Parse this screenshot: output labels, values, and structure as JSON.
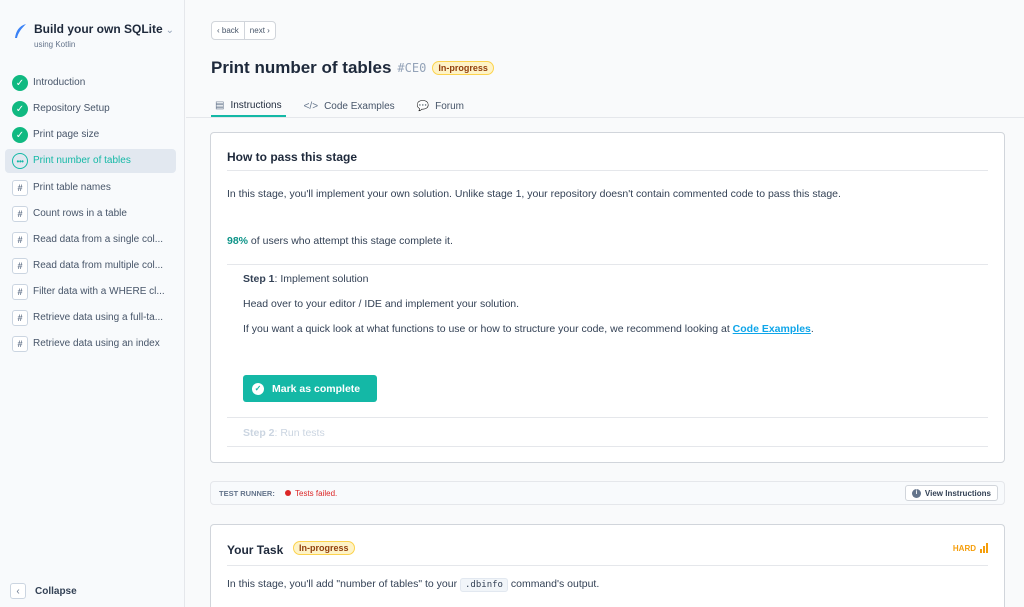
{
  "course": {
    "title": "Build your own SQLite",
    "subtitle": "using Kotlin",
    "chevron_icon": "chevron-down-icon",
    "logo_icon": "feather-icon"
  },
  "stages": [
    {
      "label": "Introduction",
      "status": "done"
    },
    {
      "label": "Repository Setup",
      "status": "done"
    },
    {
      "label": "Print page size",
      "status": "done"
    },
    {
      "label": "Print number of tables",
      "status": "current"
    },
    {
      "label": "Print table names",
      "status": "locked"
    },
    {
      "label": "Count rows in a table",
      "status": "locked"
    },
    {
      "label": "Read data from a single col...",
      "status": "locked"
    },
    {
      "label": "Read data from multiple col...",
      "status": "locked"
    },
    {
      "label": "Filter data with a WHERE cl...",
      "status": "locked"
    },
    {
      "label": "Retrieve data using a full-ta...",
      "status": "locked"
    },
    {
      "label": "Retrieve data using an index",
      "status": "locked"
    }
  ],
  "sidebar_footer": {
    "collapse_label": "Collapse"
  },
  "header": {
    "back_label": "‹ back",
    "next_label": "next ›",
    "title": "Print number of tables",
    "code": "#CE0",
    "status_badge": "In-progress",
    "tabs": [
      {
        "label": "Instructions",
        "icon": "document-icon",
        "glyph": "▤"
      },
      {
        "label": "Code Examples",
        "icon": "code-icon",
        "glyph": "</>"
      },
      {
        "label": "Forum",
        "icon": "chat-icon",
        "glyph": "💬"
      }
    ]
  },
  "instructions": {
    "title": "How to pass this stage",
    "intro": "In this stage, you'll implement your own solution. Unlike stage 1, your repository doesn't contain commented code to pass this stage.",
    "completion_pct": "98%",
    "completion_text": " of users who attempt this stage complete it.",
    "step1_label": "Step 1",
    "step1_title": ": Implement solution",
    "step1_p1": "Head over to your editor / IDE and implement your solution.",
    "step1_p2": "If you want a quick look at what functions to use or how to structure your code, we recommend looking at ",
    "step1_link": "Code Examples",
    "step1_p2_end": ".",
    "mark_button": "Mark as complete",
    "step2_label": "Step 2",
    "step2_title": ": Run tests"
  },
  "test_runner": {
    "label": "TEST RUNNER:",
    "status": "Tests failed.",
    "status_color": "#dc2626",
    "button": "View Instructions"
  },
  "task": {
    "title": "Your Task",
    "badge": "In-progress",
    "difficulty": "HARD",
    "text_before": "In this stage, you'll add \"number of tables\" to your ",
    "code": ".dbinfo",
    "text_after": " command's output."
  },
  "colors": {
    "accent": "#14b8a6",
    "success": "#10b981",
    "warning": "#f59e0b",
    "error": "#dc2626"
  }
}
